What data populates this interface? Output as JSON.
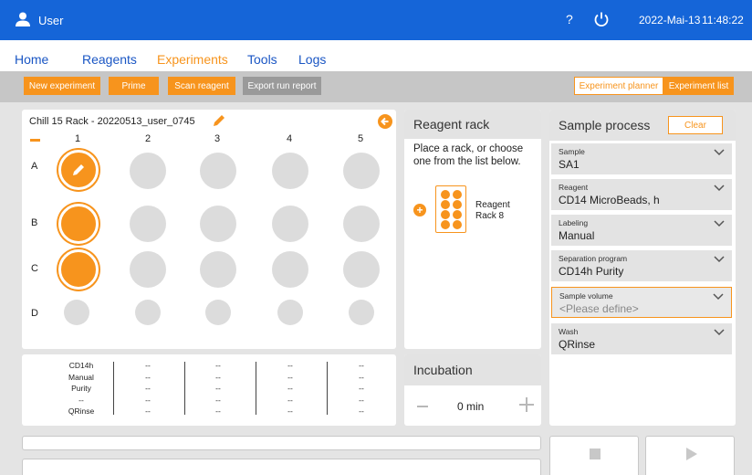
{
  "topbar": {
    "user": "User",
    "help": "?",
    "date": "2022-Mai-13",
    "time": "11:48:22"
  },
  "nav": [
    "Home",
    "Reagents",
    "Experiments",
    "Tools",
    "Logs"
  ],
  "toolbar": {
    "new_experiment": "New experiment",
    "prime": "Prime",
    "scan_reagent": "Scan reagent",
    "export_run_report": "Export run report",
    "experiment_planner": "Experiment planner",
    "experiment_list": "Experiment list"
  },
  "rack": {
    "title": "Chill 15 Rack - 20220513_user_0745",
    "columns": [
      "1",
      "2",
      "3",
      "4",
      "5"
    ],
    "rows": [
      "A",
      "B",
      "C",
      "D"
    ]
  },
  "summary": {
    "col1": [
      "CD14h",
      "Manual",
      "Purity",
      "--",
      "QRinse"
    ],
    "col_other": [
      "--",
      "--",
      "--",
      "--",
      "--"
    ]
  },
  "reagent_rack": {
    "title": "Reagent rack",
    "message": "Place a rack, or choose one from the list below.",
    "item_line1": "Reagent",
    "item_line2": "Rack 8"
  },
  "incubation": {
    "title": "Incubation",
    "value": "0 min"
  },
  "sample_process": {
    "title": "Sample process",
    "clear": "Clear",
    "fields": [
      {
        "label": "Sample",
        "value": "SA1"
      },
      {
        "label": "Reagent",
        "value": "CD14 MicroBeads, h"
      },
      {
        "label": "Labeling",
        "value": "Manual"
      },
      {
        "label": "Separation program",
        "value": "CD14h Purity"
      },
      {
        "label": "Sample volume",
        "value": "<Please define>"
      },
      {
        "label": "Wash",
        "value": "QRinse"
      }
    ]
  },
  "colors": {
    "accent": "#f7941d",
    "topbar": "#1565d8",
    "nav_link": "#1a56c4"
  }
}
